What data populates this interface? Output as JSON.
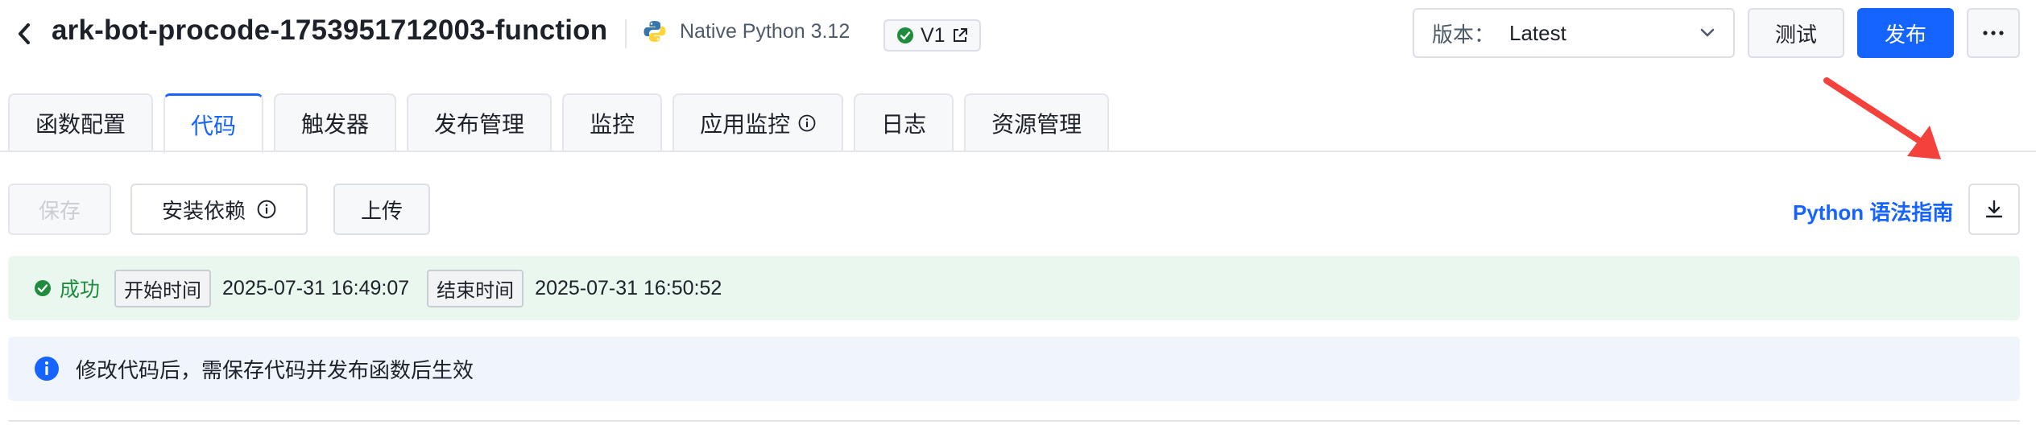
{
  "header": {
    "title": "ark-bot-procode-1753951712003-function",
    "runtime": "Native Python 3.12",
    "version_tag": "V1",
    "version_select": {
      "label": "版本：",
      "value": "Latest"
    },
    "test_label": "测试",
    "publish_label": "发布",
    "more_label": "···"
  },
  "tabs": [
    {
      "label": "函数配置",
      "active": false
    },
    {
      "label": "代码",
      "active": true
    },
    {
      "label": "触发器",
      "active": false
    },
    {
      "label": "发布管理",
      "active": false
    },
    {
      "label": "监控",
      "active": false
    },
    {
      "label": "应用监控",
      "active": false,
      "info_icon": true
    },
    {
      "label": "日志",
      "active": false
    },
    {
      "label": "资源管理",
      "active": false
    }
  ],
  "toolbar": {
    "save_label": "保存",
    "install_label": "安装依赖",
    "upload_label": "上传",
    "guide_label": "Python 语法指南"
  },
  "status": {
    "result": "成功",
    "start_label": "开始时间",
    "start_time": "2025-07-31 16:49:07",
    "end_label": "结束时间",
    "end_time": "2025-07-31 16:50:52"
  },
  "info": {
    "message": "修改代码后，需保存代码并发布函数后生效"
  },
  "colors": {
    "primary": "#1664ff",
    "success": "#1f8b3c",
    "success_bg": "#eaf7ee",
    "info_bg": "#f0f4fd",
    "annotation": "#f5413b"
  },
  "icons": [
    "back-arrow-icon",
    "python-icon",
    "check-circle-icon",
    "external-link-icon",
    "chevron-down-icon",
    "more-icon",
    "info-circle-icon",
    "download-icon"
  ]
}
